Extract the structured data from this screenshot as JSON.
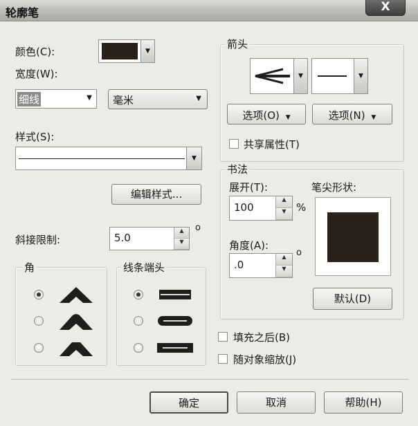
{
  "window": {
    "title": "轮廓笔",
    "close_label": "X"
  },
  "color": {
    "label": "颜色(C):",
    "swatch": "#2a2218"
  },
  "width": {
    "label": "宽度(W):",
    "value": "细线",
    "unit": "毫米"
  },
  "style": {
    "label": "样式(S):"
  },
  "edit_style_button": "编辑样式...",
  "miter": {
    "label": "斜接限制:",
    "value": "5.0",
    "unit": "o"
  },
  "corner": {
    "title": "角",
    "selected_index": 0
  },
  "line_caps": {
    "title": "线条端头",
    "selected_index": 0
  },
  "arrows": {
    "title": "箭头",
    "options_left": "选项(O)",
    "options_right": "选项(N)",
    "share": "共享属性(T)"
  },
  "calligraphy": {
    "title": "书法",
    "stretch_label": "展开(T):",
    "stretch_value": "100",
    "stretch_unit": "%",
    "nib_label": "笔尖形状:",
    "angle_label": "角度(A):",
    "angle_value": ".0",
    "angle_unit": "o",
    "default_button": "默认(D)"
  },
  "behind_fill": "填充之后(B)",
  "scale_with_image": "随对象缩放(J)",
  "footer": {
    "ok": "确定",
    "cancel": "取消",
    "help": "帮助(H)"
  },
  "colors": {
    "swatch": "#2a2218",
    "dialog_bg": "#ecebe6",
    "glyph": "#1e1e1c"
  }
}
